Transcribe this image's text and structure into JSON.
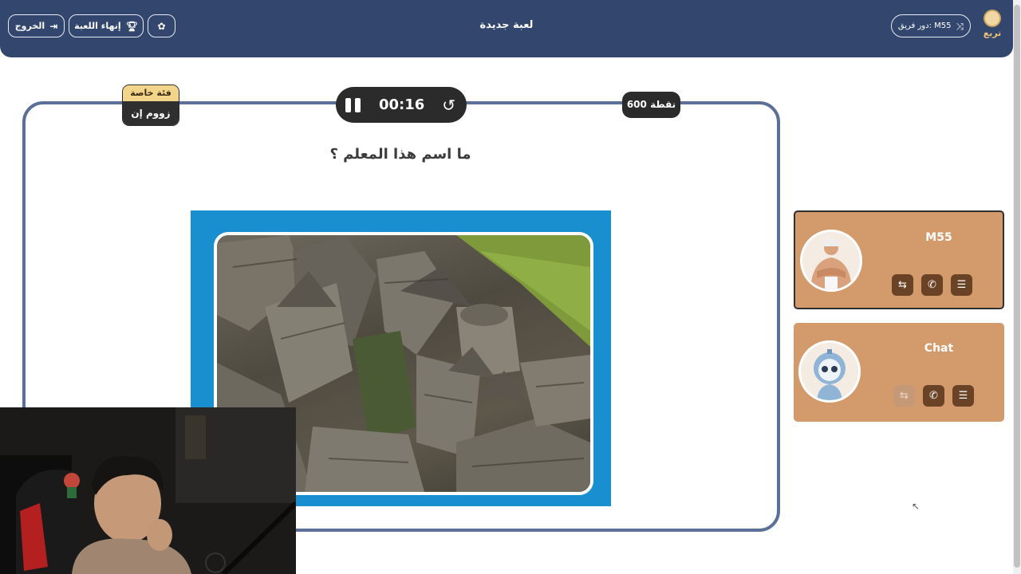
{
  "header": {
    "exit_label": "الخروج",
    "exit_icon": "logout-icon",
    "end_game_label": "إنهاء اللعبة",
    "end_game_icon": "trophy-icon",
    "palette_icon": "palette-icon",
    "title": "لعبة جديدة",
    "turn_label": "دور فريق: M55",
    "turn_icon": "shuffle-icon",
    "logo_text": "تربع"
  },
  "question_card": {
    "category_type": "فئة خاصة",
    "category_name": "زووم إن",
    "timer": "00:16",
    "points": "600 نقطة",
    "question": "ما اسم هذا المعلم ؟"
  },
  "players": [
    {
      "name": "M55",
      "avatar": "muscle-man-avatar",
      "actions": [
        "swap-icon",
        "phone-icon",
        "list-icon"
      ]
    },
    {
      "name": "Chat",
      "avatar": "robot-avatar",
      "actions": [
        "swap-icon",
        "phone-icon",
        "list-icon"
      ],
      "first_action_disabled": true
    }
  ],
  "colors": {
    "header_bg": "#33466e",
    "card_border": "#5c6f98",
    "player_bg": "#d39a6b",
    "action_bg": "#6a4327",
    "image_frame": "#1a8fd0"
  }
}
